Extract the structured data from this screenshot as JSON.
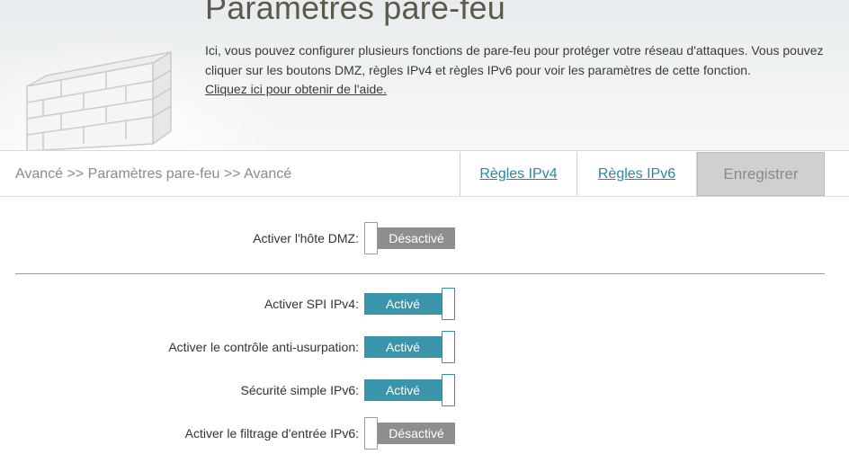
{
  "header": {
    "title": "Paramètres pare-feu",
    "description": "Ici, vous pouvez configurer plusieurs fonctions de pare-feu pour protéger votre réseau d'attaques. Vous pouvez cliquer sur les boutons DMZ, règles IPv4 et règles IPv6 pour voir les paramètres de cette fonction.",
    "help_link": "Cliquez ici pour obtenir de l'aide.",
    "icon": "brick-wall-icon"
  },
  "nav": {
    "breadcrumb": "Avancé >> Paramètres pare-feu >> Avancé",
    "ipv4_rules": "Règles IPv4",
    "ipv6_rules": "Règles IPv6",
    "save": "Enregistrer"
  },
  "settings": {
    "dmz": {
      "label": "Activer l'hôte DMZ:",
      "state": "Désactivé",
      "enabled": false
    },
    "spi_ipv4": {
      "label": "Activer SPI IPv4:",
      "state": "Activé",
      "enabled": true
    },
    "anti_spoofing": {
      "label": "Activer le contrôle anti-usurpation:",
      "state": "Activé",
      "enabled": true
    },
    "ipv6_simple_security": {
      "label": "Sécurité simple IPv6:",
      "state": "Activé",
      "enabled": true
    },
    "ipv6_ingress_filtering": {
      "label": "Activer le filtrage d'entrée IPv6:",
      "state": "Désactivé",
      "enabled": false
    }
  },
  "colors": {
    "toggle_on": "#3a95ab",
    "toggle_off": "#8e8e8e",
    "link": "#2b87a3",
    "save_bg": "#d0d0d0"
  }
}
